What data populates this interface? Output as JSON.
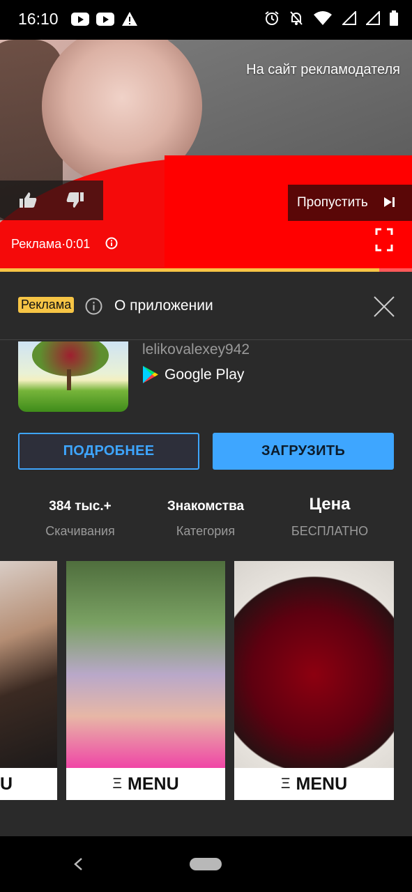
{
  "status_bar": {
    "time": "16:10",
    "left_icons": [
      "youtube-icon",
      "youtube-icon",
      "warning-icon"
    ],
    "right_icons": [
      "alarm-icon",
      "notifications-off-icon",
      "wifi-icon",
      "signal-icon",
      "signal-icon",
      "battery-icon"
    ]
  },
  "video": {
    "advertiser_link": "На сайт рекламодателя",
    "skip_label": "Пропустить",
    "ad_time": "Реклама·0:01",
    "progress_percent": 92,
    "controls": [
      "like-icon",
      "dislike-icon",
      "skip-next-icon",
      "fullscreen-icon",
      "info-icon"
    ]
  },
  "sheet": {
    "badge": "Реклама",
    "title": "О приложении",
    "developer": "lelikovalexey942",
    "store": "Google Play",
    "button_more": "ПОДРОБНЕЕ",
    "button_install": "ЗАГРУЗИТЬ",
    "stats": [
      {
        "value": "384 тыс.+",
        "label": "Скачивания"
      },
      {
        "value": "Знакомства",
        "label": "Категория"
      },
      {
        "value": "Цена",
        "label": "БЕСПЛАТНО"
      }
    ],
    "screenshots": [
      {
        "menu_label": "U"
      },
      {
        "menu_label": "MENU"
      },
      {
        "menu_label": "MENU"
      }
    ],
    "menu_glyph": "Ξ"
  },
  "colors": {
    "accent_blue": "#3ea6ff",
    "ad_yellow": "#f6c445",
    "sheet_bg": "#2a2a2a",
    "red": "#ff0000"
  }
}
